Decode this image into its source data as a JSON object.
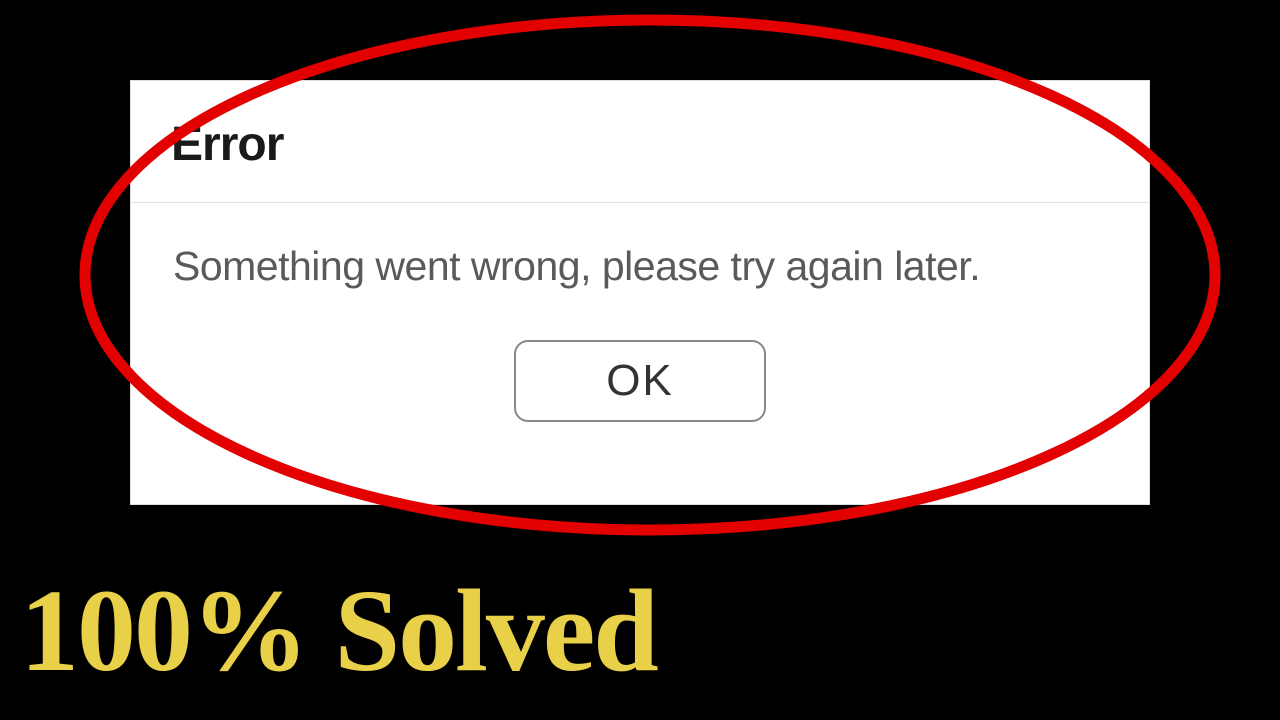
{
  "dialog": {
    "title": "Error",
    "message": "Something went wrong, please try again later.",
    "ok_label": "OK"
  },
  "annotation": {
    "caption": "100% Solved",
    "highlight_color": "#e20000",
    "caption_color": "#e8d048"
  }
}
